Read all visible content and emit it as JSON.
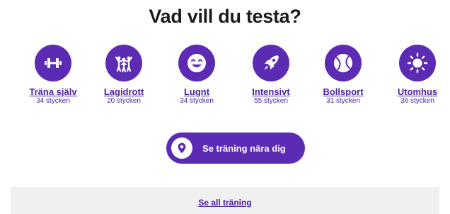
{
  "heading": "Vad vill du testa?",
  "categories": [
    {
      "label": "Träna själv",
      "count": "34 stycken",
      "icon": "dumbbell-icon"
    },
    {
      "label": "Lagidrott",
      "count": "20 stycken",
      "icon": "team-cheer-icon"
    },
    {
      "label": "Lugnt",
      "count": "34 stycken",
      "icon": "happy-face-icon"
    },
    {
      "label": "Intensivt",
      "count": "55 stycken",
      "icon": "rocket-icon"
    },
    {
      "label": "Bollsport",
      "count": "31 stycken",
      "icon": "ball-icon"
    },
    {
      "label": "Utomhus",
      "count": "36 stycken",
      "icon": "sun-icon"
    }
  ],
  "cta": {
    "label": "Se träning nära dig",
    "icon": "location-pin-icon"
  },
  "footer": {
    "link": "Se all träning"
  },
  "colors": {
    "accent": "#5c2bb3",
    "link": "#4a1fa0",
    "footer_bg": "#f0f0f0"
  }
}
